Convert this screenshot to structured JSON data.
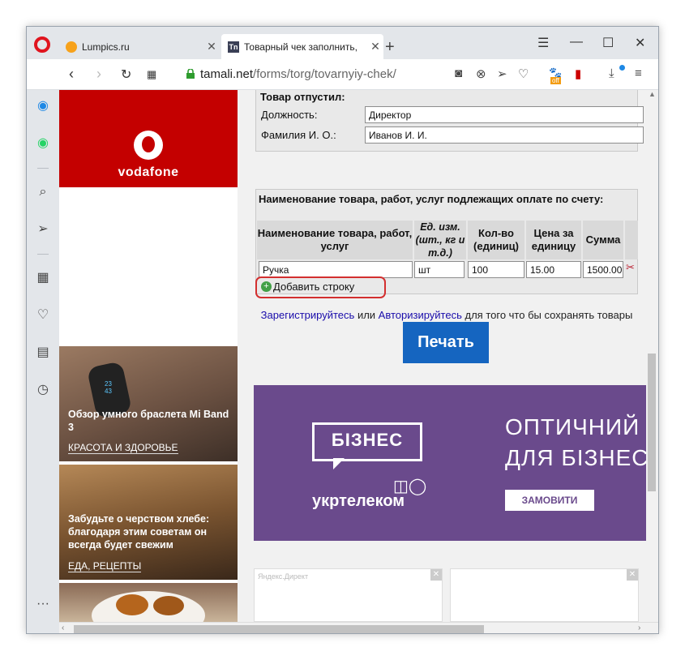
{
  "browser": {
    "tabs": [
      {
        "title": "Lumpics.ru"
      },
      {
        "title": "Товарный чек заполнить,"
      }
    ],
    "new_tab": "+",
    "url_host": "tamali.net",
    "url_path": "/forms/torg/tovarnyiy-chek/",
    "badge_off": "off"
  },
  "left_ads": {
    "vodafone": "vodafone",
    "cards": [
      {
        "title": "Обзор умного браслета Mi Band 3",
        "category": "КРАСОТА И ЗДОРОВЬЕ"
      },
      {
        "title": "Забудьте о черством хлебе: благодаря этим советам он всегда будет свежим",
        "category": "ЕДА, РЕЦЕПТЫ"
      }
    ],
    "band_time": "23\n43"
  },
  "form": {
    "released_title": "Товар отпустил:",
    "position_label": "Должность:",
    "position_value": "Директор",
    "name_label": "Фамилия И. О.:",
    "name_value": "Иванов И. И.",
    "goods_title": "Наименование товара, работ, услуг подлежащих оплате по счету:",
    "headers": {
      "name": "Наименование товара, работ, услуг",
      "unit": "Ед. изм. (шт., кг и т.д.)",
      "qty": "Кол-во (единиц)",
      "price": "Цена за единицу",
      "sum": "Сумма"
    },
    "row": {
      "name": "Ручка",
      "unit": "шт",
      "qty": "100",
      "price": "15.00",
      "sum": "1500.00"
    },
    "add_row": "Добавить строку",
    "register_link": "Зарегистрируйтесь",
    "or": "или",
    "login_link": "Авторизируйтесь",
    "save_text": "для того что бы сохранять товары",
    "print_button": "Печать"
  },
  "banner": {
    "line1": "ОПТИЧНИЙ",
    "line2": "ДЛЯ БІЗНЕС",
    "bubble": "БІЗНЕС",
    "brand": "укртелеком",
    "button": "ЗАМОВИТИ",
    "yandex": "Яндекс.Директ"
  },
  "colors": {
    "accent_red": "#e0141e",
    "vodafone": "#c40000",
    "print": "#1565c0",
    "banner": "#6a4a8c",
    "highlight": "#d32f2f"
  }
}
